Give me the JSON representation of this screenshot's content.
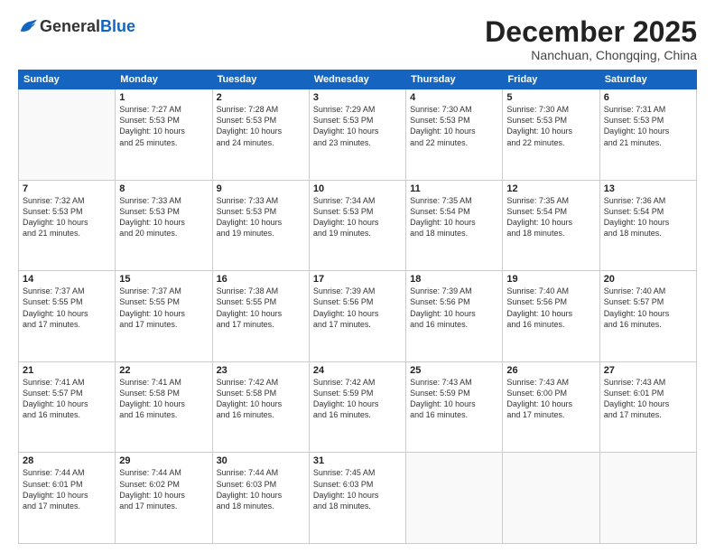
{
  "header": {
    "logo_general": "General",
    "logo_blue": "Blue",
    "month": "December 2025",
    "location": "Nanchuan, Chongqing, China"
  },
  "days_of_week": [
    "Sunday",
    "Monday",
    "Tuesday",
    "Wednesday",
    "Thursday",
    "Friday",
    "Saturday"
  ],
  "weeks": [
    [
      {
        "day": "",
        "info": ""
      },
      {
        "day": "1",
        "info": "Sunrise: 7:27 AM\nSunset: 5:53 PM\nDaylight: 10 hours\nand 25 minutes."
      },
      {
        "day": "2",
        "info": "Sunrise: 7:28 AM\nSunset: 5:53 PM\nDaylight: 10 hours\nand 24 minutes."
      },
      {
        "day": "3",
        "info": "Sunrise: 7:29 AM\nSunset: 5:53 PM\nDaylight: 10 hours\nand 23 minutes."
      },
      {
        "day": "4",
        "info": "Sunrise: 7:30 AM\nSunset: 5:53 PM\nDaylight: 10 hours\nand 22 minutes."
      },
      {
        "day": "5",
        "info": "Sunrise: 7:30 AM\nSunset: 5:53 PM\nDaylight: 10 hours\nand 22 minutes."
      },
      {
        "day": "6",
        "info": "Sunrise: 7:31 AM\nSunset: 5:53 PM\nDaylight: 10 hours\nand 21 minutes."
      }
    ],
    [
      {
        "day": "7",
        "info": "Sunrise: 7:32 AM\nSunset: 5:53 PM\nDaylight: 10 hours\nand 21 minutes."
      },
      {
        "day": "8",
        "info": "Sunrise: 7:33 AM\nSunset: 5:53 PM\nDaylight: 10 hours\nand 20 minutes."
      },
      {
        "day": "9",
        "info": "Sunrise: 7:33 AM\nSunset: 5:53 PM\nDaylight: 10 hours\nand 19 minutes."
      },
      {
        "day": "10",
        "info": "Sunrise: 7:34 AM\nSunset: 5:53 PM\nDaylight: 10 hours\nand 19 minutes."
      },
      {
        "day": "11",
        "info": "Sunrise: 7:35 AM\nSunset: 5:54 PM\nDaylight: 10 hours\nand 18 minutes."
      },
      {
        "day": "12",
        "info": "Sunrise: 7:35 AM\nSunset: 5:54 PM\nDaylight: 10 hours\nand 18 minutes."
      },
      {
        "day": "13",
        "info": "Sunrise: 7:36 AM\nSunset: 5:54 PM\nDaylight: 10 hours\nand 18 minutes."
      }
    ],
    [
      {
        "day": "14",
        "info": "Sunrise: 7:37 AM\nSunset: 5:55 PM\nDaylight: 10 hours\nand 17 minutes."
      },
      {
        "day": "15",
        "info": "Sunrise: 7:37 AM\nSunset: 5:55 PM\nDaylight: 10 hours\nand 17 minutes."
      },
      {
        "day": "16",
        "info": "Sunrise: 7:38 AM\nSunset: 5:55 PM\nDaylight: 10 hours\nand 17 minutes."
      },
      {
        "day": "17",
        "info": "Sunrise: 7:39 AM\nSunset: 5:56 PM\nDaylight: 10 hours\nand 17 minutes."
      },
      {
        "day": "18",
        "info": "Sunrise: 7:39 AM\nSunset: 5:56 PM\nDaylight: 10 hours\nand 16 minutes."
      },
      {
        "day": "19",
        "info": "Sunrise: 7:40 AM\nSunset: 5:56 PM\nDaylight: 10 hours\nand 16 minutes."
      },
      {
        "day": "20",
        "info": "Sunrise: 7:40 AM\nSunset: 5:57 PM\nDaylight: 10 hours\nand 16 minutes."
      }
    ],
    [
      {
        "day": "21",
        "info": "Sunrise: 7:41 AM\nSunset: 5:57 PM\nDaylight: 10 hours\nand 16 minutes."
      },
      {
        "day": "22",
        "info": "Sunrise: 7:41 AM\nSunset: 5:58 PM\nDaylight: 10 hours\nand 16 minutes."
      },
      {
        "day": "23",
        "info": "Sunrise: 7:42 AM\nSunset: 5:58 PM\nDaylight: 10 hours\nand 16 minutes."
      },
      {
        "day": "24",
        "info": "Sunrise: 7:42 AM\nSunset: 5:59 PM\nDaylight: 10 hours\nand 16 minutes."
      },
      {
        "day": "25",
        "info": "Sunrise: 7:43 AM\nSunset: 5:59 PM\nDaylight: 10 hours\nand 16 minutes."
      },
      {
        "day": "26",
        "info": "Sunrise: 7:43 AM\nSunset: 6:00 PM\nDaylight: 10 hours\nand 17 minutes."
      },
      {
        "day": "27",
        "info": "Sunrise: 7:43 AM\nSunset: 6:01 PM\nDaylight: 10 hours\nand 17 minutes."
      }
    ],
    [
      {
        "day": "28",
        "info": "Sunrise: 7:44 AM\nSunset: 6:01 PM\nDaylight: 10 hours\nand 17 minutes."
      },
      {
        "day": "29",
        "info": "Sunrise: 7:44 AM\nSunset: 6:02 PM\nDaylight: 10 hours\nand 17 minutes."
      },
      {
        "day": "30",
        "info": "Sunrise: 7:44 AM\nSunset: 6:03 PM\nDaylight: 10 hours\nand 18 minutes."
      },
      {
        "day": "31",
        "info": "Sunrise: 7:45 AM\nSunset: 6:03 PM\nDaylight: 10 hours\nand 18 minutes."
      },
      {
        "day": "",
        "info": ""
      },
      {
        "day": "",
        "info": ""
      },
      {
        "day": "",
        "info": ""
      }
    ]
  ]
}
